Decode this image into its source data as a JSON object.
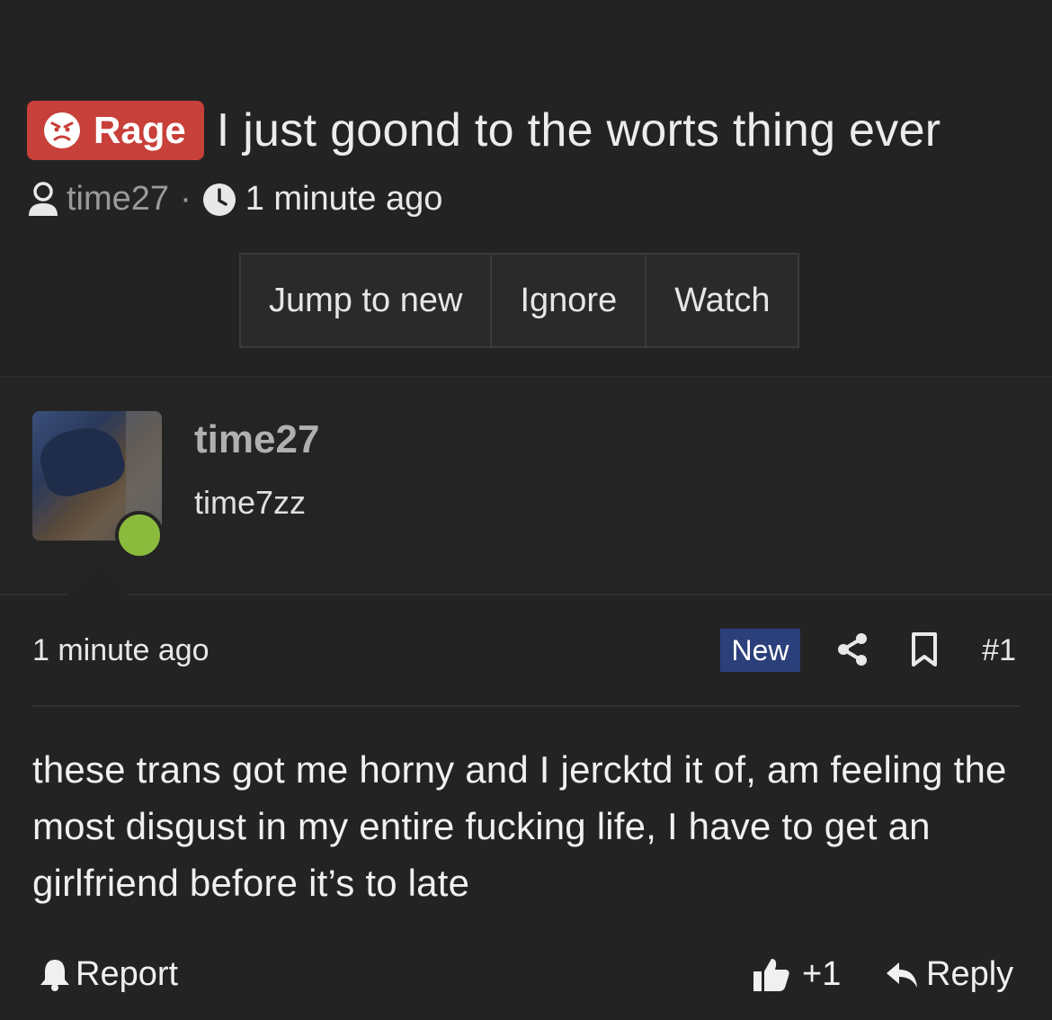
{
  "thread": {
    "prefix": "Rage",
    "title": "I just goond to the worts thing ever",
    "author": "time27",
    "separator": "·",
    "time": "1 minute ago",
    "prefix_color": "#c8403a"
  },
  "actions": {
    "jump_to_new": "Jump to new",
    "ignore": "Ignore",
    "watch": "Watch"
  },
  "user": {
    "name": "time27",
    "title": "time7zz",
    "online_color": "#8bbb3c"
  },
  "post": {
    "time": "1 minute ago",
    "new_label": "New",
    "number": "#1",
    "body": "these trans got me horny and I jercktd it of, am feeling the most disgust in my entire fucking life, I have to get an girlfriend before it’s to late",
    "report": "Report",
    "reaction_count": "+1",
    "reply": "Reply",
    "new_badge_color": "#2b3f7a"
  },
  "icons": {
    "prefix": "angry-face-icon",
    "author": "user-icon",
    "time": "clock-icon",
    "share": "share-icon",
    "bookmark": "bookmark-icon",
    "report": "bell-icon",
    "like": "thumbs-up-icon",
    "reply": "reply-icon"
  }
}
